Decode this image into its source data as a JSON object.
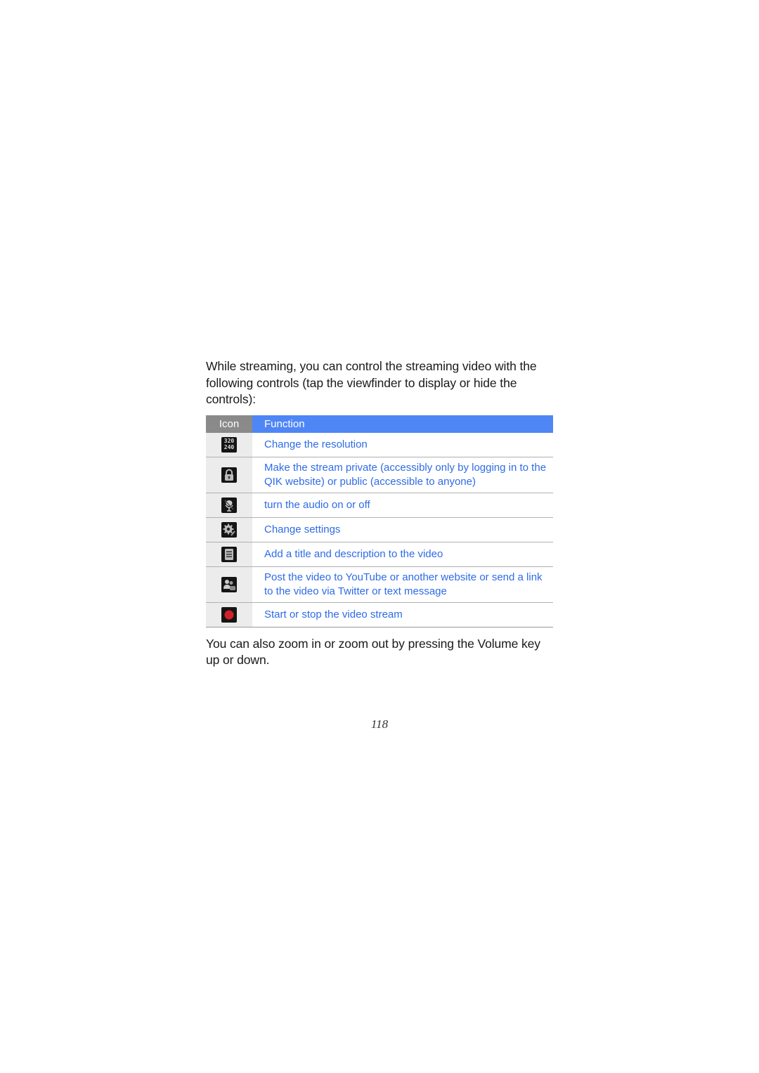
{
  "intro_text": "While streaming, you can control the streaming video with the following controls (tap the viewfinder to display or hide the controls):",
  "table": {
    "headers": {
      "icon": "Icon",
      "function": "Function"
    },
    "colors": {
      "icon_header_bg": "#8a8a8a",
      "function_header_bg": "#4f86f6",
      "function_text": "#2e6be6",
      "icon_cell_bg": "#ececec"
    },
    "rows": [
      {
        "icon": "resolution-icon",
        "icon_text": "320\n240",
        "function": "Change the resolution"
      },
      {
        "icon": "lock-icon",
        "function": "Make the stream private (accessibly only by logging in to the QIK website) or public (accessible to anyone)"
      },
      {
        "icon": "microphone-mute-icon",
        "function": "turn the audio on or off"
      },
      {
        "icon": "settings-gear-icon",
        "function": "Change settings"
      },
      {
        "icon": "document-icon",
        "function": "Add a title and description to the video"
      },
      {
        "icon": "share-contacts-icon",
        "function": "Post the video to YouTube or another website or send a link to the video via Twitter or text message"
      },
      {
        "icon": "record-icon",
        "function": "Start or stop the video stream"
      }
    ]
  },
  "outro_text": "You can also zoom in or zoom out by pressing the Volume key up or down.",
  "page_number": "118"
}
